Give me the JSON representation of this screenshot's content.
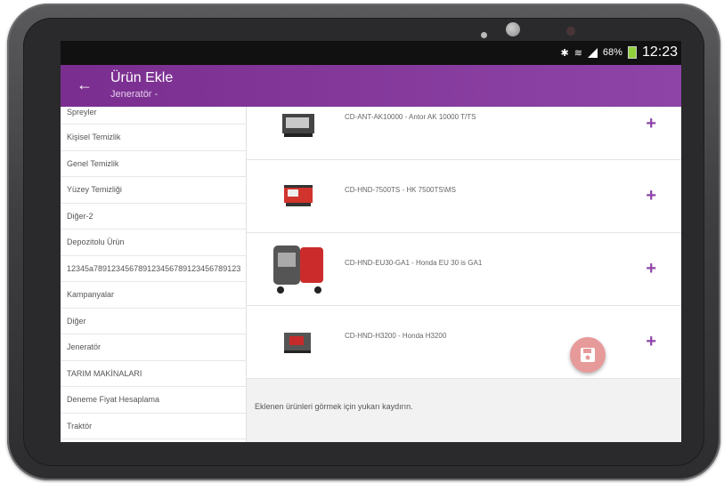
{
  "status": {
    "battery": "68%",
    "time": "12:23"
  },
  "appbar": {
    "back_icon": "arrow-left-icon",
    "title": "Ürün Ekle",
    "subtitle": "Jeneratör -"
  },
  "sidebar": {
    "items": [
      "Spreyler",
      "Kişisel Temizlik",
      "Genel Temizlik",
      "Yüzey Temizliği",
      "Diğer-2",
      "Depozitolu Ürün",
      "12345a789123456789123456789123456789123",
      "Kampanyalar",
      "Diğer",
      "Jeneratör",
      "TARIM MAKİNALARI",
      "Deneme Fiyat Hesaplama",
      "Traktör"
    ]
  },
  "products": [
    {
      "name": "CD-ANT-AK10000 - Antor AK 10000 T/TS",
      "add": "+"
    },
    {
      "name": "CD-HND-7500TS - HK 7500TS\\MS",
      "add": "+"
    },
    {
      "name": "CD-HND-EU30-GA1 - Honda EU 30 is GA1",
      "add": "+"
    },
    {
      "name": "CD-HND-H3200 - Honda H3200",
      "add": "+"
    }
  ],
  "footer": {
    "hint": "Eklenen ürünleri görmek için yukarı kaydırın."
  },
  "fab": {
    "icon": "save-icon",
    "color": "#e79a9a"
  },
  "colors": {
    "accent": "#8e44a7"
  }
}
